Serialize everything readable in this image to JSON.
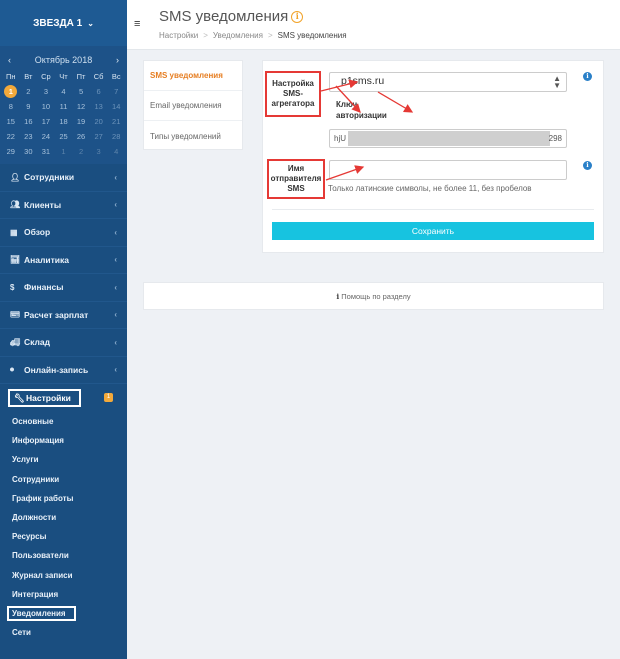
{
  "brand": {
    "name": "ЗВЕЗДА 1"
  },
  "calendar": {
    "month": "Октябрь 2018",
    "weekdays": [
      "Пн",
      "Вт",
      "Ср",
      "Чт",
      "Пт",
      "Сб",
      "Вс"
    ],
    "weeks": [
      [
        "1",
        "2",
        "3",
        "4",
        "5",
        "6",
        "7"
      ],
      [
        "8",
        "9",
        "10",
        "11",
        "12",
        "13",
        "14"
      ],
      [
        "15",
        "16",
        "17",
        "18",
        "19",
        "20",
        "21"
      ],
      [
        "22",
        "23",
        "24",
        "25",
        "26",
        "27",
        "28"
      ],
      [
        "29",
        "30",
        "31",
        "1",
        "2",
        "3",
        "4"
      ]
    ]
  },
  "sidebar": {
    "items": [
      {
        "label": "Сотрудники"
      },
      {
        "label": "Клиенты"
      },
      {
        "label": "Обзор"
      },
      {
        "label": "Аналитика"
      },
      {
        "label": "Финансы"
      },
      {
        "label": "Расчет зарплат"
      },
      {
        "label": "Склад"
      },
      {
        "label": "Онлайн-запись"
      }
    ],
    "settings": {
      "label": "Настройки",
      "badge": "1"
    },
    "submenu": [
      "Основные",
      "Информация",
      "Услуги",
      "Сотрудники",
      "График работы",
      "Должности",
      "Ресурсы",
      "Пользователи",
      "Журнал записи",
      "Интеграция",
      "Уведомления",
      "Сети"
    ]
  },
  "header": {
    "title": "SMS уведомления",
    "info_glyph": "i",
    "breadcrumb": [
      "Настройки",
      "Уведомления",
      "SMS уведомления"
    ],
    "menu_glyph": "≡"
  },
  "tabs": [
    "SMS уведомления",
    "Email уведомления",
    "Типы уведомлений"
  ],
  "form": {
    "aggregator_label": "Настройка SMS-агрегатора",
    "aggregator_value": "p1sms.ru",
    "key_label_line1": "Ключ",
    "key_label_line2": "авторизации",
    "key_prefix": "hjU",
    "key_suffix": "298",
    "sender_label": "Имя отправителя SMS",
    "sender_value": "",
    "sender_hint": "Только латинские символы, не более 11, без пробелов",
    "save_label": "Сохранить"
  },
  "help": {
    "label": "Помощь по разделу"
  },
  "colors": {
    "sidebar": "#1a4e80",
    "accent": "#17c3e0",
    "annotation": "#e53935",
    "tab_active": "#e67e22"
  }
}
